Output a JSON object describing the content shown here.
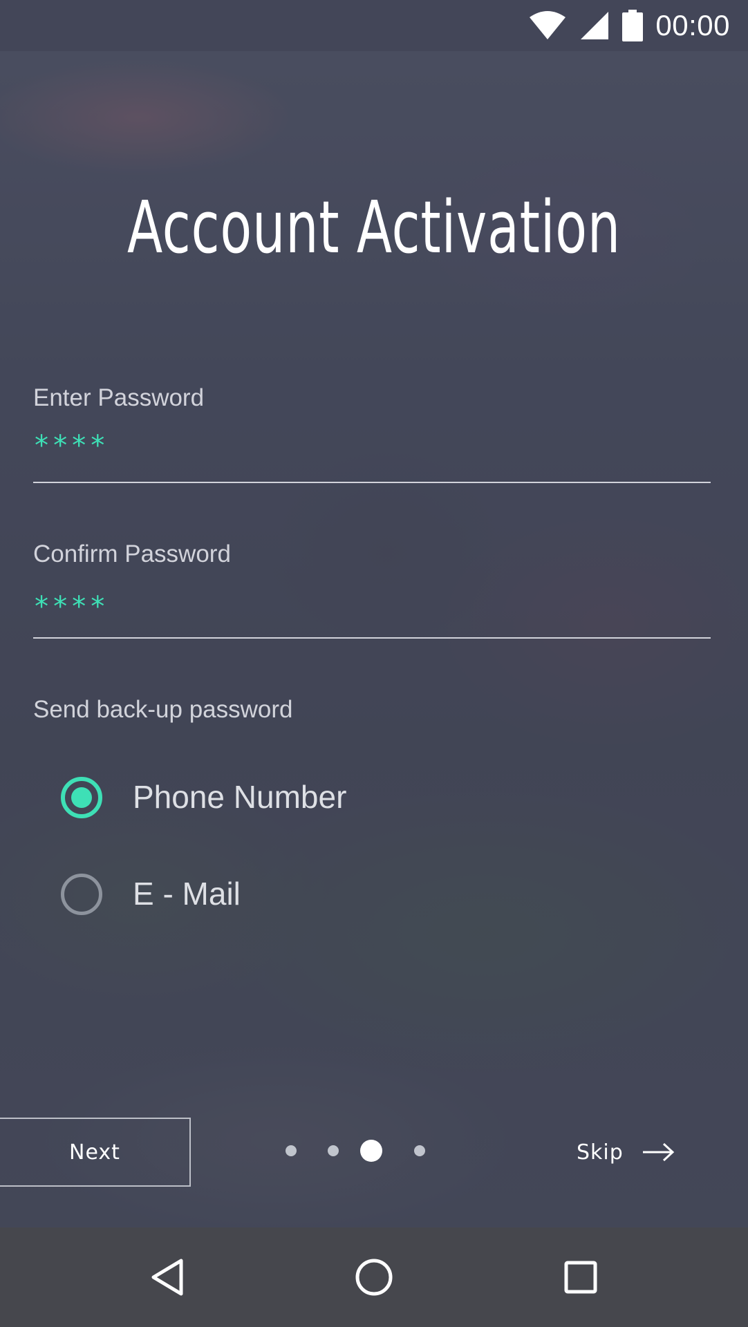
{
  "status_bar": {
    "time": "00:00",
    "icons": [
      "wifi-icon",
      "signal-icon",
      "battery-icon"
    ]
  },
  "page": {
    "title": "Account Activation"
  },
  "form": {
    "password": {
      "label": "Enter Password",
      "value": "****"
    },
    "confirm_password": {
      "label": "Confirm Password",
      "value": "****"
    },
    "backup": {
      "label": "Send back-up password",
      "options": [
        {
          "label": "Phone Number",
          "selected": true
        },
        {
          "label": "E - Mail",
          "selected": false
        }
      ]
    }
  },
  "footer": {
    "next_label": "Next",
    "skip_label": "Skip",
    "pager": {
      "total": 4,
      "active_index": 2
    }
  },
  "nav_bar": {
    "icons": [
      "back-icon",
      "home-icon",
      "recents-icon"
    ]
  },
  "colors": {
    "accent": "#3ee0b6",
    "status_bar": "#434658",
    "nav_bar": "#46474d"
  }
}
